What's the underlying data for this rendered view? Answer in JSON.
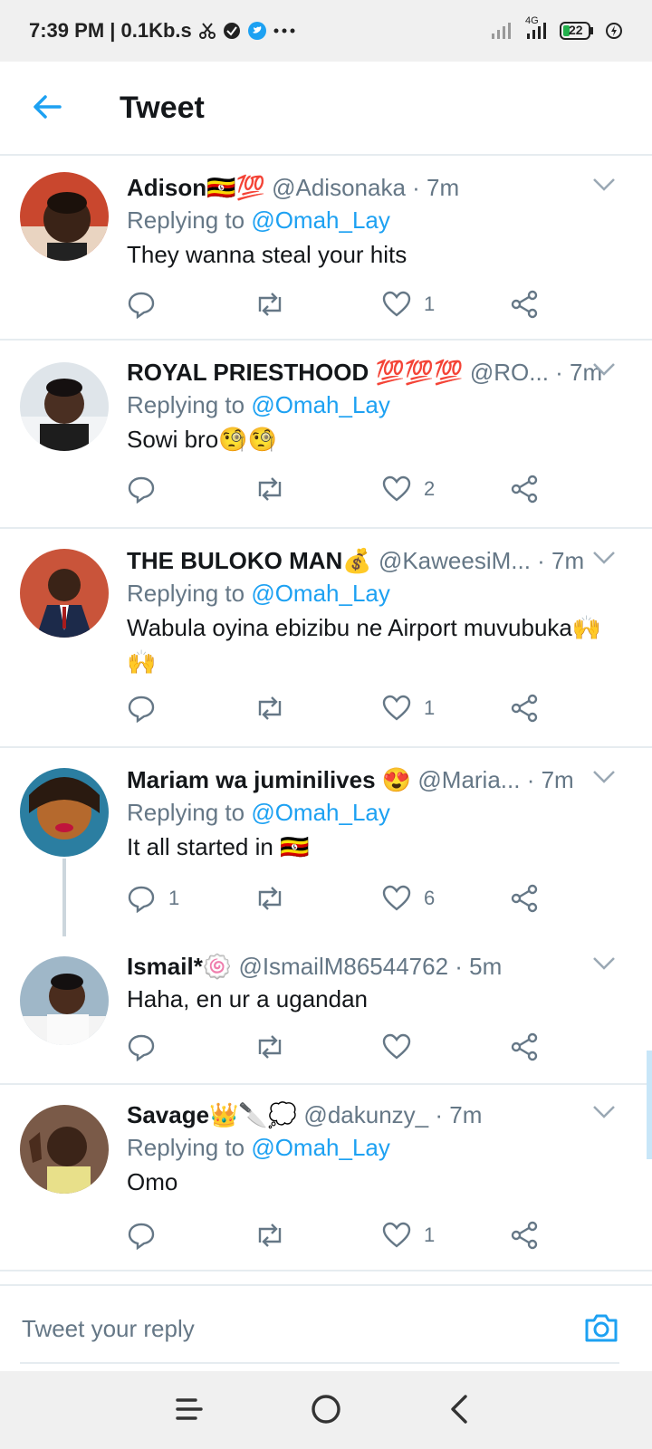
{
  "status_bar": {
    "time_info": "7:39 PM | 0.1Kb.s",
    "network": "4G",
    "battery": "22",
    "icons": [
      "scissors-icon",
      "check-circle-icon",
      "twitter-bird-icon",
      "more-dots-icon",
      "signal-icon",
      "signal-4g-icon",
      "battery-icon",
      "charging-icon"
    ]
  },
  "header": {
    "title": "Tweet",
    "back_icon": "arrow-left-icon"
  },
  "tweets": [
    {
      "name": "Adison🇺🇬💯",
      "handle": "@Adisonaka",
      "time": " · 7m",
      "replying_label": "Replying to ",
      "reply_to": "@Omah_Lay",
      "text": "They wanna steal your hits",
      "reply_count": "",
      "like_count": "1"
    },
    {
      "name": "ROYAL PRIESTHOOD 💯💯💯",
      "handle": "@RO...",
      "time": " · 7m",
      "replying_label": "Replying to ",
      "reply_to": "@Omah_Lay",
      "text": "Sowi bro🧐🧐",
      "reply_count": "",
      "like_count": "2"
    },
    {
      "name": "THE BULOKO MAN💰",
      "handle": "@KaweesiM...",
      "time": " · 7m",
      "replying_label": "Replying to ",
      "reply_to": "@Omah_Lay",
      "text": "Wabula oyina ebizibu ne Airport muvubuka🙌🙌",
      "reply_count": "",
      "like_count": "1"
    },
    {
      "name": "Mariam wa juminilives 😍",
      "handle": "@Maria...",
      "time": " · 7m",
      "replying_label": "Replying to ",
      "reply_to": "@Omah_Lay",
      "text": "It all started in 🇺🇬",
      "reply_count": "1",
      "like_count": "6"
    },
    {
      "name": "Ismail*🍥",
      "handle": "@IsmailM86544762",
      "time": " · 5m",
      "text": "Haha, en ur a ugandan",
      "reply_count": "",
      "like_count": ""
    },
    {
      "name": "Savage👑🔪💭",
      "handle": "@dakunzy_",
      "time": " · 7m",
      "replying_label": "Replying to ",
      "reply_to": "@Omah_Lay",
      "text": "Omo",
      "reply_count": "",
      "like_count": "1"
    }
  ],
  "composer": {
    "placeholder": "Tweet your reply",
    "camera_icon": "camera-icon"
  },
  "nav_bar": {
    "icons": [
      "menu-icon",
      "home-circle-icon",
      "back-chevron-icon"
    ]
  },
  "colors": {
    "accent": "#1da1f2",
    "muted": "#657786",
    "text": "#14171a",
    "divider": "#e6ecf0"
  }
}
